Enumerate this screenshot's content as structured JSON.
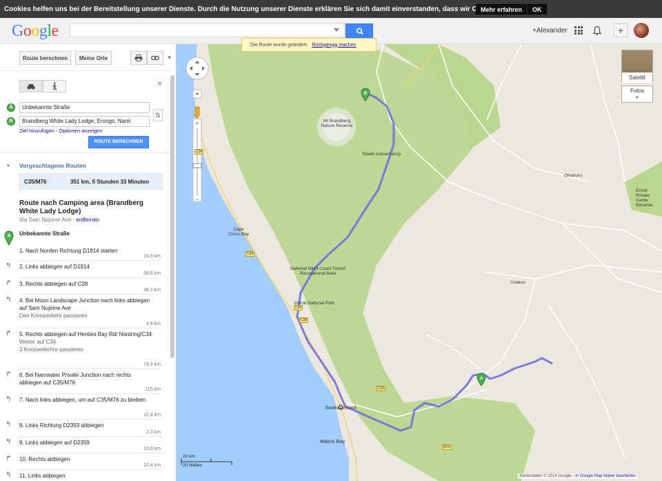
{
  "cookie_bar": {
    "message": "Cookies helfen uns bei der Bereitstellung unserer Dienste. Durch die Nutzung unserer Dienste erklären Sie sich damit einverstanden, dass wir Cookies setzen.",
    "more_label": "Mehr erfahren",
    "ok_label": "OK"
  },
  "header": {
    "logo": "Google",
    "search_value": "",
    "user_name": "+Alexander"
  },
  "notice": {
    "text": "Die Route wurde geändert.",
    "undo_label": "Rückgängig machen"
  },
  "panel": {
    "calc_route_btn": "Route berechnen",
    "my_places_btn": "Meine Orte",
    "from_value": "Unbekannte Straße",
    "to_value": "Brandberg White Lady Lodge, Erongo, Nami",
    "add_dest_link": "Ziel hinzufügen",
    "options_link": "Optionen anzeigen",
    "link_sep": " - ",
    "submit_label": "ROUTE BERECHNEN",
    "suggested_routes_label": "Vorgeschlagene Routen",
    "route_name": "C35/M76",
    "route_summary": "351 km, 5 Stunden 33 Minuten",
    "route_title": "Route nach Camping area (Brandberg White Lady Lodge)",
    "via_text": "Via Sam Nujome Ave - ",
    "remove_link": "entfernen",
    "start_label": "Unbekannte Straße",
    "marker_a": "A",
    "marker_b": "B"
  },
  "steps": [
    {
      "text": "1. Nach Norden Richtung D1914 starten",
      "sub": "",
      "dist": "14,9 km"
    },
    {
      "text": "2. Links abbiegen auf D1914",
      "sub": "",
      "dist": "68,6 km"
    },
    {
      "text": "3. Rechts abbiegen auf C28",
      "sub": "",
      "dist": "38,1 km"
    },
    {
      "text": "4. Bei Moon Landscape Junction nach links abbiegen auf Sam Nujome Ave",
      "sub": "Den Kreisverkehr passieren",
      "dist": "4,8 km"
    },
    {
      "text": "5. Rechts abbiegen auf Henties Bay Rd/ Nordring/C34",
      "sub": "Weiter auf C34",
      "sub2": "3 Kreisverkehre passieren",
      "dist": "74,8 km"
    },
    {
      "text": "6. Bei Namwater Private Junction nach rechts abbiegen auf C35/M76",
      "sub": "",
      "dist": "115 km"
    },
    {
      "text": "7. Nach links abbiegen, um auf C35/M76 zu bleiben",
      "sub": "",
      "dist": "10,4 km"
    },
    {
      "text": "8. Links Richtung D2359 abbiegen",
      "sub": "",
      "dist": "3,3 km"
    },
    {
      "text": "9. Links abbiegen auf D2359",
      "sub": "",
      "dist": "10,6 km"
    },
    {
      "text": "10. Rechts abbiegen",
      "sub": "",
      "dist": "10,4 km"
    },
    {
      "text": "11. Links abbiegen",
      "sub": "",
      "dist": ""
    }
  ],
  "map": {
    "labels": {
      "brandberg": "Mt Brandberg Nature Reserve",
      "tsiseb": "Tsiseb conservancy",
      "omaruru": "Omaruru",
      "erindi": "Erindi Private Game Reserve",
      "cape_cross": "Cape Cross Bay",
      "nwc": "National West Coast Tourist Recreational Area",
      "usakos": "Usakos",
      "dorob": "Dorob National Park",
      "swakopmund": "Swakopmund",
      "walvis": "Walvis Bay"
    },
    "satellite_label": "Satellit",
    "photos_label": "Fotos",
    "scale_km": "20 km",
    "scale_mi": "20 Meilen",
    "footer": "Kartendaten © 2014 Google -",
    "footer_link": "In Google Map Maker bearbeiten",
    "route_shields": [
      "C34",
      "C34",
      "C34",
      "C35",
      "C28",
      "M76"
    ]
  }
}
